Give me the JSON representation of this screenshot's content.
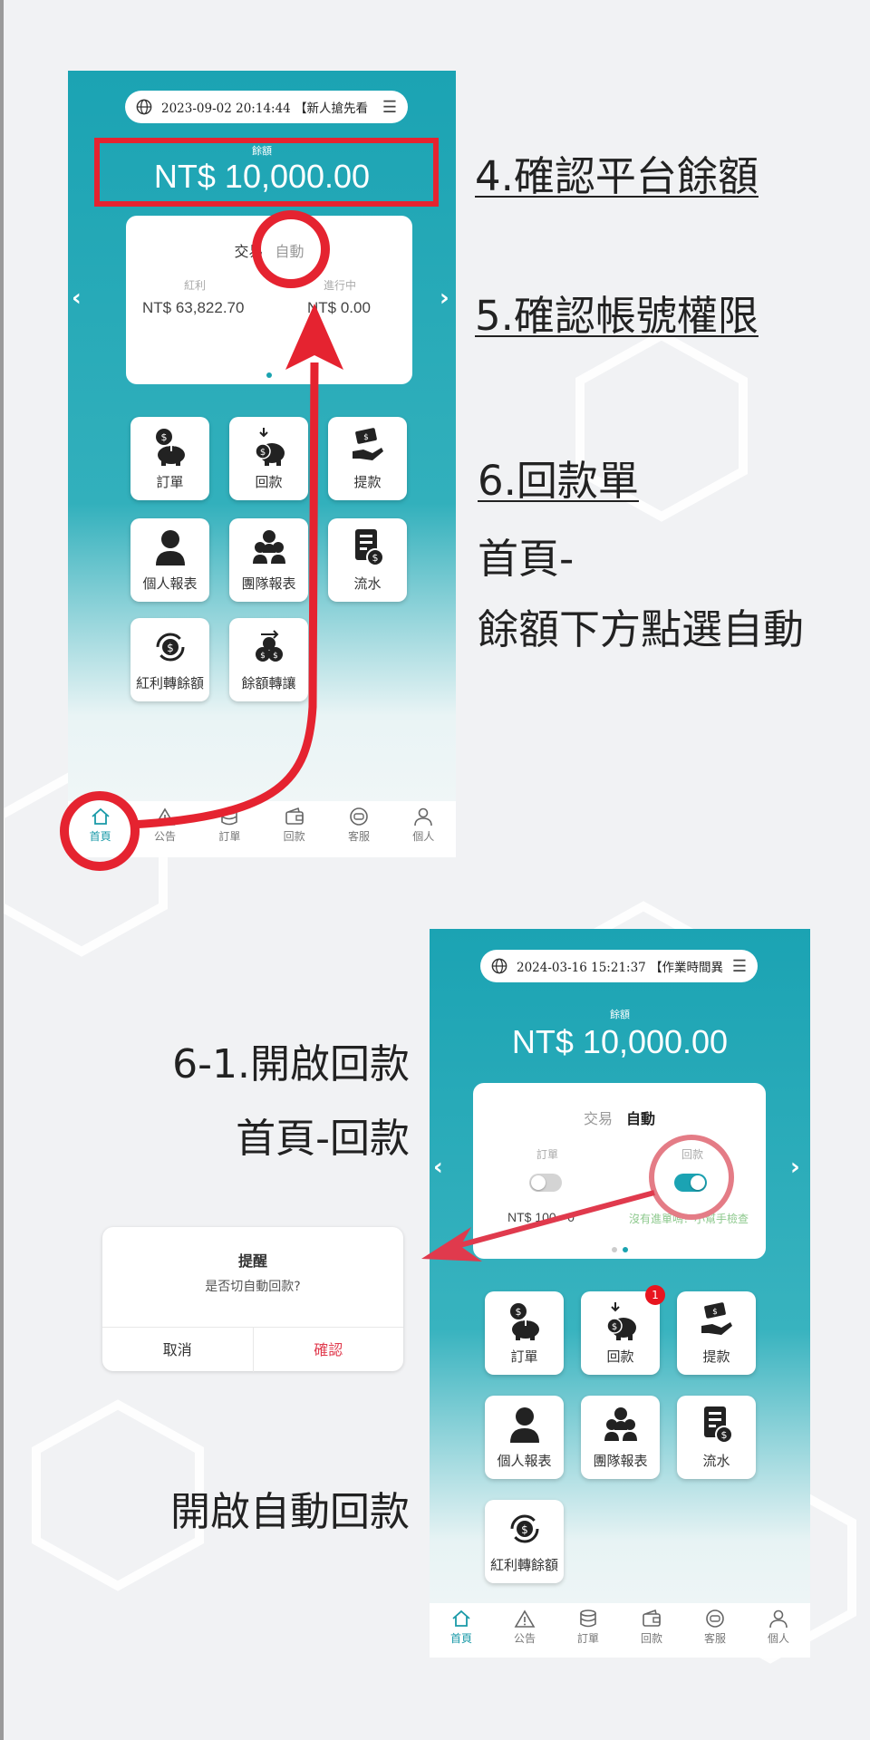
{
  "colors": {
    "teal": "#1ba3b3",
    "highlight": "#e52330",
    "accent_text": "#1a9aa8",
    "badge": "#e8151f",
    "toggle_on": "#1ba3b3"
  },
  "screen1": {
    "topbar": {
      "datetime": "2023-09-02 20:14:44",
      "ticker": "【新人搶先看",
      "globe_icon": "globe-icon",
      "menu_icon": "hamburger-icon"
    },
    "balance_label": "餘額",
    "balance": "NT$ 10,000.00",
    "card": {
      "tab_trade": "交易",
      "tab_auto": "自動",
      "bonus_label": "紅利",
      "bonus_value": "NT$ 63,822.70",
      "pending_label": "進行中",
      "pending_value": "NT$ 0.00"
    },
    "tiles": [
      "訂單",
      "回款",
      "提款",
      "個人報表",
      "團隊報表",
      "流水",
      "紅利轉餘額",
      "餘額轉讓"
    ],
    "nav": [
      "首頁",
      "公告",
      "訂單",
      "回款",
      "客服",
      "個人"
    ]
  },
  "screen2": {
    "topbar": {
      "datetime": "2024-03-16 15:21:37",
      "ticker": "【作業時間異",
      "globe_icon": "globe-icon",
      "menu_icon": "hamburger-icon"
    },
    "balance_label": "餘額",
    "balance": "NT$ 10,000.00",
    "card": {
      "tab_trade": "交易",
      "tab_auto": "自動",
      "order_label": "訂單",
      "order_toggle": false,
      "repay_label": "回款",
      "repay_toggle": true,
      "range": "NT$ 100 - 0",
      "help_text": "沒有進單嗎？小幫手檢查"
    },
    "badge_count": "1",
    "tiles": [
      "訂單",
      "回款",
      "提款",
      "個人報表",
      "團隊報表",
      "流水",
      "紅利轉餘額"
    ],
    "nav": [
      "首頁",
      "公告",
      "訂單",
      "回款",
      "客服",
      "個人"
    ]
  },
  "dialog": {
    "title": "提醒",
    "message": "是否切自動回款?",
    "cancel": "取消",
    "confirm": "確認"
  },
  "instructions": {
    "step4": "4.確認平台餘額",
    "step5": "5.確認帳號權限",
    "step6": "6.回款單",
    "step6_line2": "首頁-",
    "step6_line3": "餘額下方點選自動",
    "step6_1": "6-1.開啟回款",
    "step6_1_line2": "首頁-回款",
    "enable_auto": "開啟自動回款"
  }
}
